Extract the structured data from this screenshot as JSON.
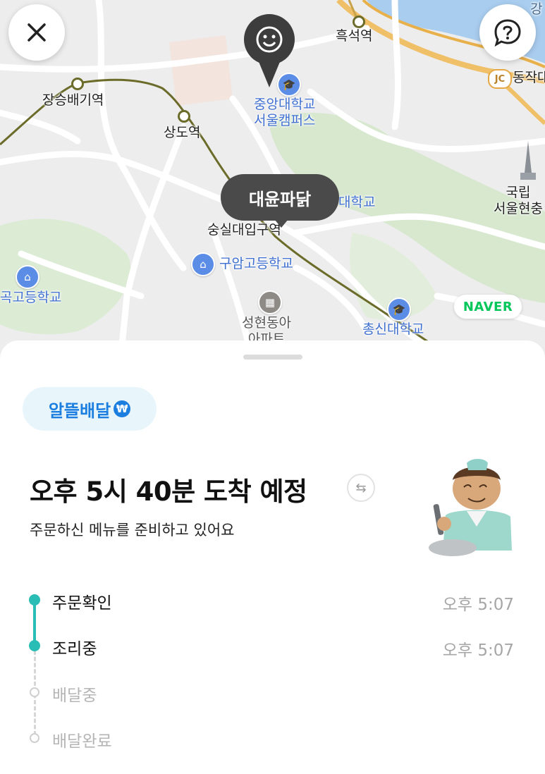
{
  "map": {
    "labels": {
      "heukseok_station": "흑석역",
      "jangseungbaegi_station": "장승배기역",
      "sangdo_station": "상도역",
      "chungang_univ": "중앙대학교\n서울캠퍼스",
      "soongsil_univ": "대학교",
      "soongsil_station": "숭실대입구역",
      "guam_high": "구암고등학교",
      "high_school_left": "곡고등학교",
      "seonghyeon_apt": "성현동아\n아파트",
      "chongshin_univ": "총신대학교",
      "national_cemetery": "국립\n서울현충",
      "dongjak_jc": "동작대",
      "jc_badge": "JC",
      "river_label": "강"
    },
    "store_bubble": "대윤파닭",
    "naver_logo": "NAVER"
  },
  "buttons": {
    "close_icon": "close-icon",
    "help_icon": "help-icon"
  },
  "sheet": {
    "badge_label": "알뜰배달",
    "badge_symbol": "₩",
    "eta_text": "오후 5시 40분 도착 예정",
    "subtitle": "주문하신 메뉴를 준비하고 있어요",
    "steps": [
      {
        "label": "주문확인",
        "time": "오후 5:07",
        "done": true
      },
      {
        "label": "조리중",
        "time": "오후 5:07",
        "done": true
      },
      {
        "label": "배달중",
        "time": "",
        "done": false
      },
      {
        "label": "배달완료",
        "time": "",
        "done": false
      }
    ]
  },
  "colors": {
    "accent_teal": "#29bdb6",
    "badge_blue": "#1c7fe0",
    "naver_green": "#03c75a"
  }
}
